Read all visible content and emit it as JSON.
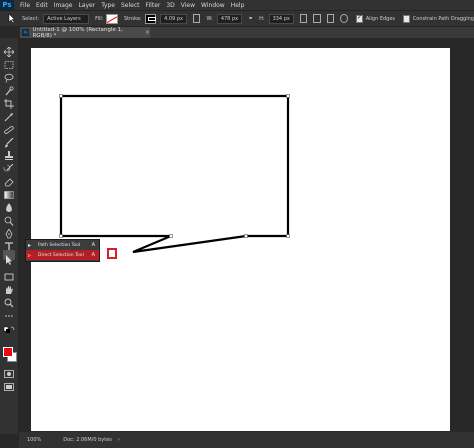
{
  "app": {
    "logo": "Ps"
  },
  "menu": [
    "File",
    "Edit",
    "Image",
    "Layer",
    "Type",
    "Select",
    "Filter",
    "3D",
    "View",
    "Window",
    "Help"
  ],
  "options": {
    "select_label": "Select:",
    "select_value": "Active Layers",
    "fill_label": "Fill:",
    "stroke_label": "Stroke:",
    "stroke_width": "4.09 px",
    "w_label": "W:",
    "w_value": "478 px",
    "h_label": "H:",
    "h_value": "334 px",
    "align_edges": "Align Edges",
    "constrain": "Constrain Path Dragging",
    "colors": {
      "fill": "#ffffff",
      "stroke": "#000000"
    }
  },
  "document": {
    "tab_title": "Untitled-1 @ 100% (Rectangle 1, RGB/8) *",
    "close": "×"
  },
  "flyout": {
    "item1": {
      "icon": "arrow-black-icon",
      "label": "Path Selection Tool",
      "key": "A"
    },
    "item2": {
      "icon": "arrow-white-icon",
      "label": "Direct Selection Tool",
      "key": "A"
    }
  },
  "status": {
    "zoom": "100%",
    "doc": "Doc: 2.06M/0 bytes",
    "arrow": "›"
  },
  "colors": {
    "foreground": "#e20b16",
    "background": "#ffffff",
    "highlight": "#d4212b"
  },
  "tools": [
    "move-icon",
    "marquee-icon",
    "lasso-icon",
    "quick-select-icon",
    "crop-icon",
    "eyedropper-icon",
    "healing-icon",
    "brush-icon",
    "clone-stamp-icon",
    "history-brush-icon",
    "eraser-icon",
    "gradient-icon",
    "blur-icon",
    "dodge-icon",
    "pen-icon",
    "type-icon",
    "path-selection-icon",
    "rectangle-icon",
    "hand-icon",
    "zoom-icon",
    "more-tools-icon"
  ]
}
